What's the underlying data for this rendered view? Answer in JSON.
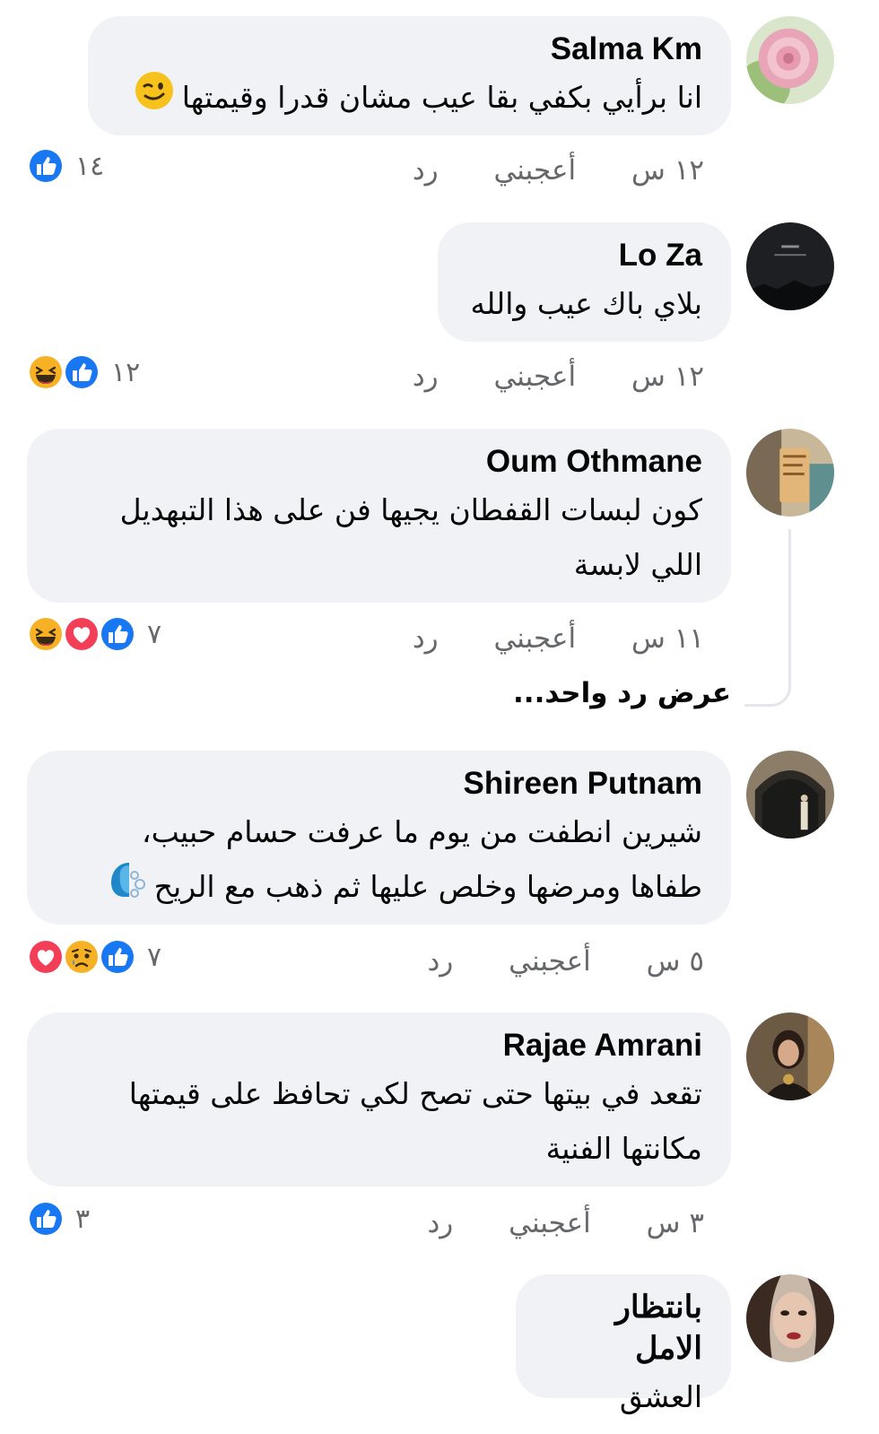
{
  "comments": [
    {
      "author": "Salma Km",
      "lines": [
        "انا برأيي بكفي بقا عيب مشان قدرا وقيمتها"
      ],
      "time": "١٢ س",
      "like": "أعجبني",
      "reply": "رد",
      "reaction_count": "١٤",
      "reactions": [
        "like"
      ]
    },
    {
      "author": "Lo Za",
      "lines": [
        "بلاي باك عيب والله"
      ],
      "time": "١٢ س",
      "like": "أعجبني",
      "reply": "رد",
      "reaction_count": "١٢",
      "reactions": [
        "like",
        "haha"
      ]
    },
    {
      "author": "Oum Othmane",
      "lines": [
        "كون لبسات القفطان يجيها فن على هذا التبهديل",
        "اللي لابسة"
      ],
      "time": "١١ س",
      "like": "أعجبني",
      "reply": "رد",
      "reaction_count": "٧",
      "reactions": [
        "like",
        "love",
        "haha"
      ],
      "view_replies": "عرض رد واحد..."
    },
    {
      "author": "Shireen Putnam",
      "lines": [
        "شيرين انطفت من يوم ما عرفت حسام حبيب،",
        "طفاها ومرضها وخلص عليها ثم ذهب مع الريح"
      ],
      "time": "٥ س",
      "like": "أعجبني",
      "reply": "رد",
      "reaction_count": "٧",
      "reactions": [
        "like",
        "sad",
        "love"
      ]
    },
    {
      "author": "Rajae Amrani",
      "lines": [
        "تقعد في بيتها حتى تصح لكي تحافظ على قيمتها",
        "مكانتها الفنية"
      ],
      "time": "٣ س",
      "like": "أعجبني",
      "reply": "رد",
      "reaction_count": "٣",
      "reactions": [
        "like"
      ]
    },
    {
      "author": "بانتظار الامل",
      "lines": [
        "العشق شيري"
      ]
    }
  ],
  "colors": {
    "bubble": "#f0f2f5",
    "meta_text": "#65676b",
    "like_blue": "#1877f2",
    "love_red": "#f33e58",
    "reaction_yellow": "#f7b125"
  }
}
